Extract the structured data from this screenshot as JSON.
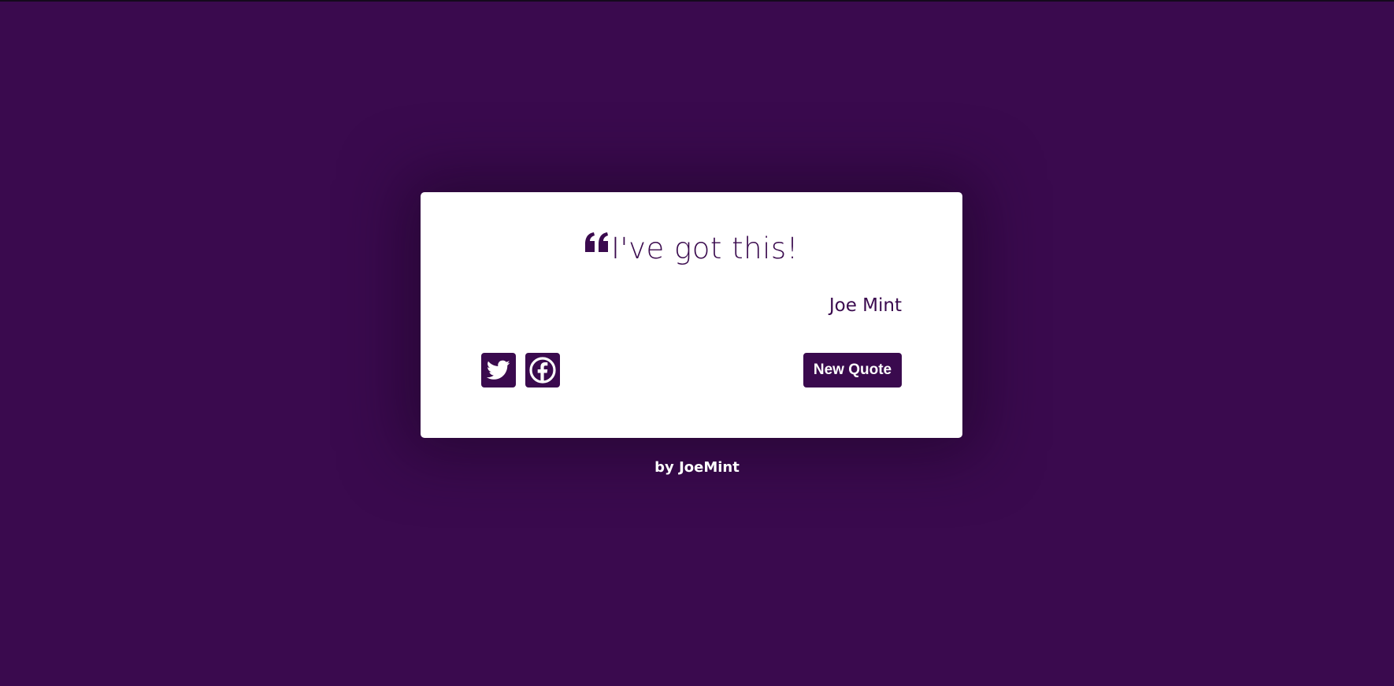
{
  "colors": {
    "background": "#3a0a4e",
    "card": "#ffffff",
    "accent": "#3a0a4e",
    "text_on_accent": "#ffffff"
  },
  "quote": {
    "icon": "quote-left-icon",
    "text": "I've got this!",
    "author": "Joe Mint"
  },
  "actions": {
    "twitter_icon": "twitter-icon",
    "facebook_icon": "facebook-icon",
    "new_quote_label": "New Quote"
  },
  "footer": {
    "prefix": "by",
    "author_link": "JoeMint"
  }
}
